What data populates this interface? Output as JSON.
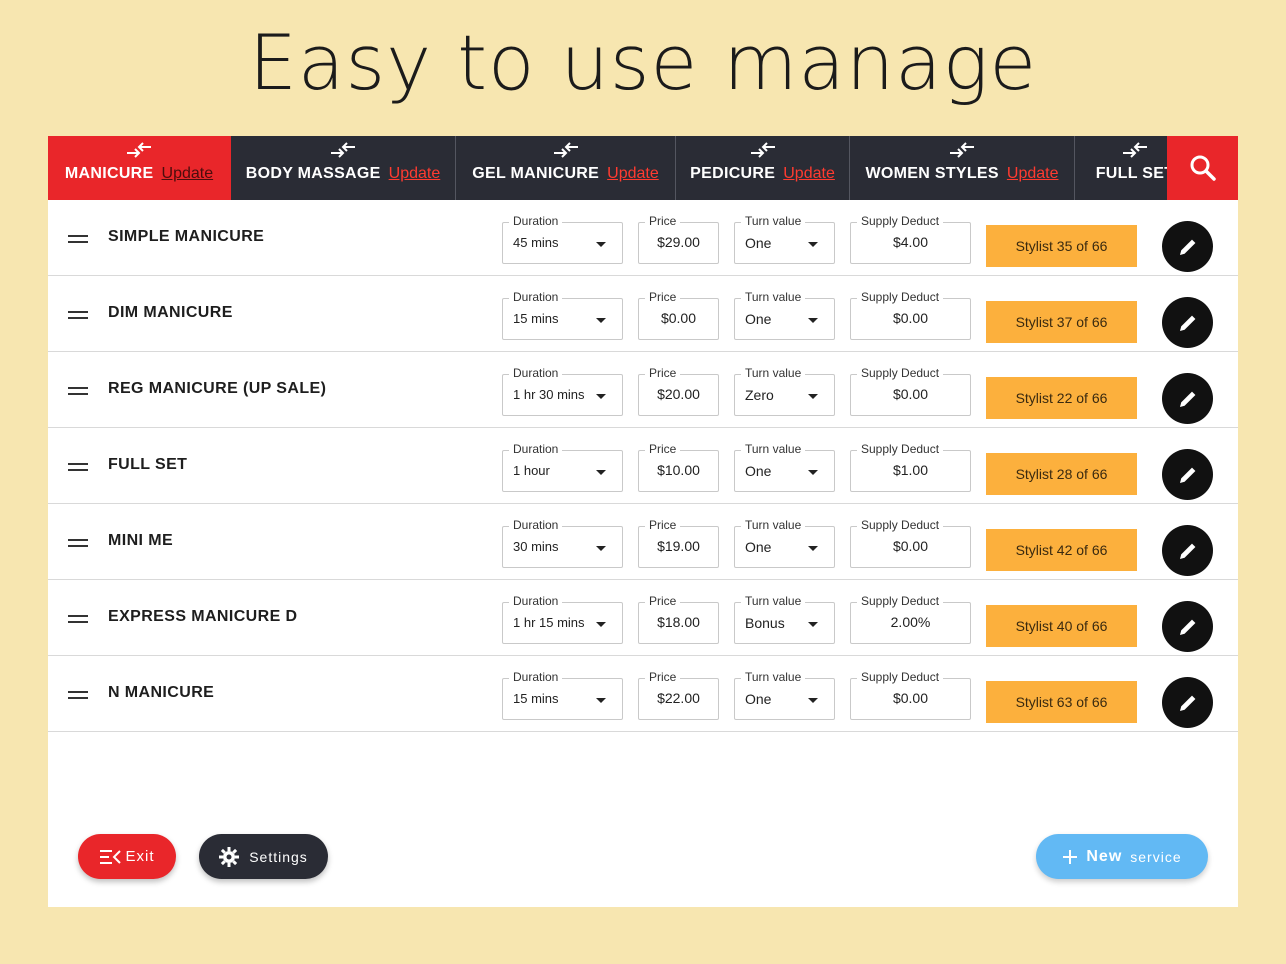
{
  "headline": "Easy to use manage",
  "colors": {
    "background": "#f7e6b0",
    "tabbar": "#2a2c35",
    "accent_red": "#e9262a",
    "stylist_orange": "#fcb03d",
    "new_blue": "#62b9f4"
  },
  "tabs": [
    {
      "name": "MANICURE",
      "update": "Update",
      "active": true
    },
    {
      "name": "BODY MASSAGE",
      "update": "Update"
    },
    {
      "name": "GEL MANICURE",
      "update": "Update"
    },
    {
      "name": "PEDICURE",
      "update": "Update"
    },
    {
      "name": "WOMEN STYLES",
      "update": "Update"
    },
    {
      "name": "FULL SET",
      "update": ""
    }
  ],
  "labels": {
    "duration": "Duration",
    "price": "Price",
    "turn": "Turn value",
    "supply": "Supply Deduct"
  },
  "services": [
    {
      "name": "SIMPLE MANICURE",
      "duration": "45 mins",
      "price": "$29.00",
      "turn": "One",
      "supply": "$4.00",
      "stylist": "Stylist 35 of 66"
    },
    {
      "name": "DIM MANICURE",
      "duration": "15 mins",
      "price": "$0.00",
      "turn": "One",
      "supply": "$0.00",
      "stylist": "Stylist 37 of 66"
    },
    {
      "name": "REG MANICURE (UP SALE)",
      "duration": "1 hr 30 mins",
      "price": "$20.00",
      "turn": "Zero",
      "supply": "$0.00",
      "stylist": "Stylist 22 of 66"
    },
    {
      "name": "FULL SET",
      "duration": "1 hour",
      "price": "$10.00",
      "turn": "One",
      "supply": "$1.00",
      "stylist": "Stylist 28 of 66"
    },
    {
      "name": "MINI ME",
      "duration": "30 mins",
      "price": "$19.00",
      "turn": "One",
      "supply": "$0.00",
      "stylist": "Stylist 42 of 66"
    },
    {
      "name": "EXPRESS MANICURE D",
      "duration": "1 hr 15 mins",
      "price": "$18.00",
      "turn": "Bonus",
      "supply": "2.00%",
      "stylist": "Stylist 40 of 66"
    },
    {
      "name": "N MANICURE",
      "duration": "15 mins",
      "price": "$22.00",
      "turn": "One",
      "supply": "$0.00",
      "stylist": "Stylist 63 of 66"
    }
  ],
  "footer": {
    "exit": "Exit",
    "settings": "Settings",
    "new_strong": "New",
    "new_rest": "service"
  },
  "icons": {
    "tab": "swap-arrows-icon",
    "search": "search-icon",
    "handle": "drag-handle-icon",
    "edit": "pencil-icon",
    "exit": "exit-menu-icon",
    "settings": "gear-icon",
    "add": "plus-icon"
  }
}
